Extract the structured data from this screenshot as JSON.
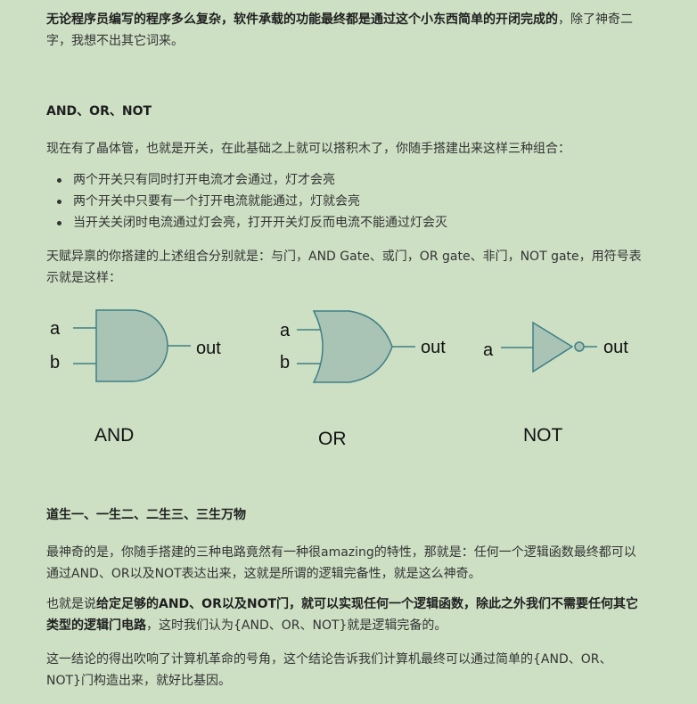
{
  "intro": {
    "bold": "无论程序员编写的程序多么复杂，软件承载的功能最终都是通过这个小东西简单的开闭完成的",
    "rest": "，除了神奇二字，我想不出其它词来。"
  },
  "heading1": "AND、OR、NOT",
  "para1": "现在有了晶体管，也就是开关，在此基础之上就可以搭积木了，你随手搭建出来这样三种组合：",
  "bullets": [
    "两个开关只有同时打开电流才会通过，灯才会亮",
    "两个开关中只要有一个打开电流就能通过，灯就会亮",
    "当开关关闭时电流通过灯会亮，打开开关灯反而电流不能通过灯会灭"
  ],
  "para2": "天赋异禀的你搭建的上述组合分别就是：与门，AND Gate、或门，OR gate、非门，NOT gate，用符号表示就是这样：",
  "gates": {
    "and": {
      "input_a": "a",
      "input_b": "b",
      "output": "out",
      "caption": "AND"
    },
    "or": {
      "input_a": "a",
      "input_b": "b",
      "output": "out",
      "caption": "OR"
    },
    "not": {
      "input_a": "a",
      "output": "out",
      "caption": "NOT"
    }
  },
  "heading2": "道生一、一生二、二生三、三生万物",
  "para3": "最神奇的是，你随手搭建的三种电路竟然有一种很amazing的特性，那就是：任何一个逻辑函数最终都可以通过AND、OR以及NOT表达出来，这就是所谓的逻辑完备性，就是这么神奇。",
  "para4": {
    "pre": "也就是说",
    "bold": "给定足够的AND、OR以及NOT门，就可以实现任何一个逻辑函数，除此之外我们不需要任何其它类型的逻辑门电路",
    "post": "，这时我们认为{AND、OR、NOT}就是逻辑完备的。"
  },
  "para5": "这一结论的得出吹响了计算机革命的号角，这个结论告诉我们计算机最终可以通过简单的{AND、OR、NOT}门构造出来，就好比基因。",
  "colors": {
    "background": "#cde0c4",
    "gate_fill": "#a9c3b5",
    "gate_stroke": "#3f7f86",
    "text": "#333333"
  }
}
